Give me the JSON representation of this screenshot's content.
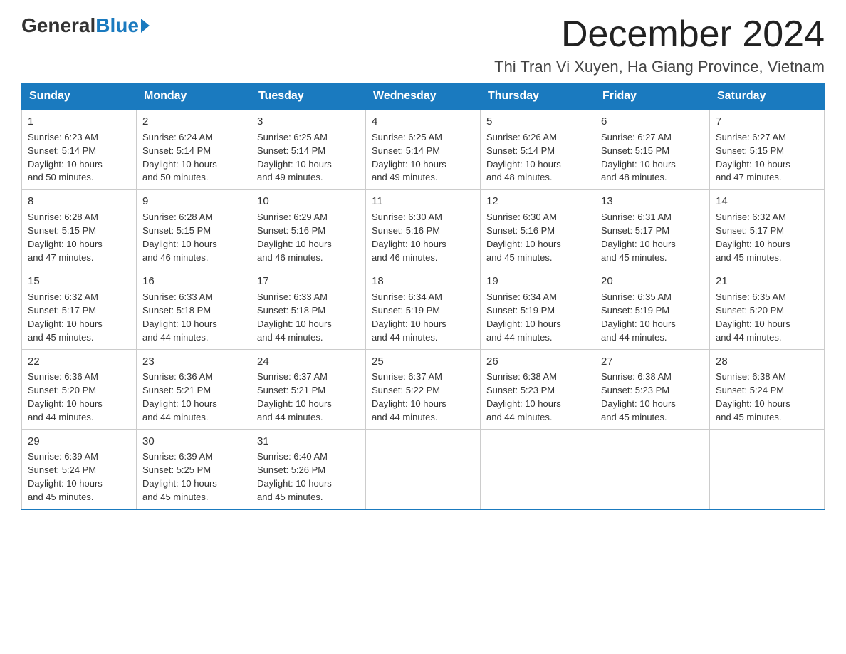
{
  "logo": {
    "general": "General",
    "blue": "Blue"
  },
  "header": {
    "month": "December 2024",
    "location": "Thi Tran Vi Xuyen, Ha Giang Province, Vietnam"
  },
  "days_of_week": [
    "Sunday",
    "Monday",
    "Tuesday",
    "Wednesday",
    "Thursday",
    "Friday",
    "Saturday"
  ],
  "weeks": [
    [
      {
        "day": "1",
        "sunrise": "6:23 AM",
        "sunset": "5:14 PM",
        "daylight": "10 hours and 50 minutes."
      },
      {
        "day": "2",
        "sunrise": "6:24 AM",
        "sunset": "5:14 PM",
        "daylight": "10 hours and 50 minutes."
      },
      {
        "day": "3",
        "sunrise": "6:25 AM",
        "sunset": "5:14 PM",
        "daylight": "10 hours and 49 minutes."
      },
      {
        "day": "4",
        "sunrise": "6:25 AM",
        "sunset": "5:14 PM",
        "daylight": "10 hours and 49 minutes."
      },
      {
        "day": "5",
        "sunrise": "6:26 AM",
        "sunset": "5:14 PM",
        "daylight": "10 hours and 48 minutes."
      },
      {
        "day": "6",
        "sunrise": "6:27 AM",
        "sunset": "5:15 PM",
        "daylight": "10 hours and 48 minutes."
      },
      {
        "day": "7",
        "sunrise": "6:27 AM",
        "sunset": "5:15 PM",
        "daylight": "10 hours and 47 minutes."
      }
    ],
    [
      {
        "day": "8",
        "sunrise": "6:28 AM",
        "sunset": "5:15 PM",
        "daylight": "10 hours and 47 minutes."
      },
      {
        "day": "9",
        "sunrise": "6:28 AM",
        "sunset": "5:15 PM",
        "daylight": "10 hours and 46 minutes."
      },
      {
        "day": "10",
        "sunrise": "6:29 AM",
        "sunset": "5:16 PM",
        "daylight": "10 hours and 46 minutes."
      },
      {
        "day": "11",
        "sunrise": "6:30 AM",
        "sunset": "5:16 PM",
        "daylight": "10 hours and 46 minutes."
      },
      {
        "day": "12",
        "sunrise": "6:30 AM",
        "sunset": "5:16 PM",
        "daylight": "10 hours and 45 minutes."
      },
      {
        "day": "13",
        "sunrise": "6:31 AM",
        "sunset": "5:17 PM",
        "daylight": "10 hours and 45 minutes."
      },
      {
        "day": "14",
        "sunrise": "6:32 AM",
        "sunset": "5:17 PM",
        "daylight": "10 hours and 45 minutes."
      }
    ],
    [
      {
        "day": "15",
        "sunrise": "6:32 AM",
        "sunset": "5:17 PM",
        "daylight": "10 hours and 45 minutes."
      },
      {
        "day": "16",
        "sunrise": "6:33 AM",
        "sunset": "5:18 PM",
        "daylight": "10 hours and 44 minutes."
      },
      {
        "day": "17",
        "sunrise": "6:33 AM",
        "sunset": "5:18 PM",
        "daylight": "10 hours and 44 minutes."
      },
      {
        "day": "18",
        "sunrise": "6:34 AM",
        "sunset": "5:19 PM",
        "daylight": "10 hours and 44 minutes."
      },
      {
        "day": "19",
        "sunrise": "6:34 AM",
        "sunset": "5:19 PM",
        "daylight": "10 hours and 44 minutes."
      },
      {
        "day": "20",
        "sunrise": "6:35 AM",
        "sunset": "5:19 PM",
        "daylight": "10 hours and 44 minutes."
      },
      {
        "day": "21",
        "sunrise": "6:35 AM",
        "sunset": "5:20 PM",
        "daylight": "10 hours and 44 minutes."
      }
    ],
    [
      {
        "day": "22",
        "sunrise": "6:36 AM",
        "sunset": "5:20 PM",
        "daylight": "10 hours and 44 minutes."
      },
      {
        "day": "23",
        "sunrise": "6:36 AM",
        "sunset": "5:21 PM",
        "daylight": "10 hours and 44 minutes."
      },
      {
        "day": "24",
        "sunrise": "6:37 AM",
        "sunset": "5:21 PM",
        "daylight": "10 hours and 44 minutes."
      },
      {
        "day": "25",
        "sunrise": "6:37 AM",
        "sunset": "5:22 PM",
        "daylight": "10 hours and 44 minutes."
      },
      {
        "day": "26",
        "sunrise": "6:38 AM",
        "sunset": "5:23 PM",
        "daylight": "10 hours and 44 minutes."
      },
      {
        "day": "27",
        "sunrise": "6:38 AM",
        "sunset": "5:23 PM",
        "daylight": "10 hours and 45 minutes."
      },
      {
        "day": "28",
        "sunrise": "6:38 AM",
        "sunset": "5:24 PM",
        "daylight": "10 hours and 45 minutes."
      }
    ],
    [
      {
        "day": "29",
        "sunrise": "6:39 AM",
        "sunset": "5:24 PM",
        "daylight": "10 hours and 45 minutes."
      },
      {
        "day": "30",
        "sunrise": "6:39 AM",
        "sunset": "5:25 PM",
        "daylight": "10 hours and 45 minutes."
      },
      {
        "day": "31",
        "sunrise": "6:40 AM",
        "sunset": "5:26 PM",
        "daylight": "10 hours and 45 minutes."
      },
      {
        "day": "",
        "sunrise": "",
        "sunset": "",
        "daylight": ""
      },
      {
        "day": "",
        "sunrise": "",
        "sunset": "",
        "daylight": ""
      },
      {
        "day": "",
        "sunrise": "",
        "sunset": "",
        "daylight": ""
      },
      {
        "day": "",
        "sunrise": "",
        "sunset": "",
        "daylight": ""
      }
    ]
  ]
}
